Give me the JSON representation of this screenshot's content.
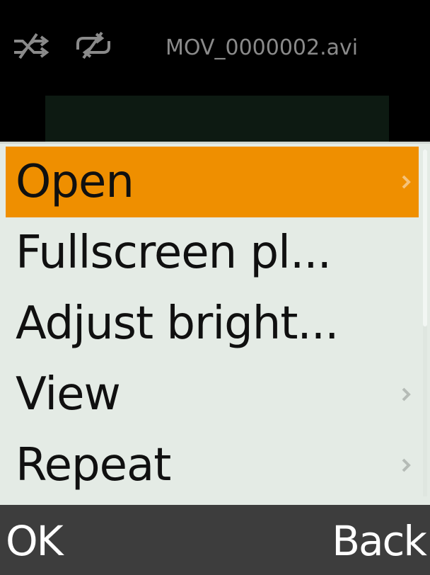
{
  "header": {
    "filename": "MOV_0000002.avi",
    "shuffle_icon": "shuffle-off-icon",
    "repeat_icon": "repeat-off-icon"
  },
  "menu": {
    "items": [
      {
        "label": "Open",
        "has_submenu": true,
        "selected": true
      },
      {
        "label": "Fullscreen pl...",
        "has_submenu": false,
        "selected": false
      },
      {
        "label": "Adjust bright...",
        "has_submenu": false,
        "selected": false
      },
      {
        "label": "View",
        "has_submenu": true,
        "selected": false
      },
      {
        "label": "Repeat",
        "has_submenu": true,
        "selected": false
      }
    ]
  },
  "softkeys": {
    "left": "OK",
    "right": "Back"
  },
  "colors": {
    "selection": "#ef8f00",
    "menu_background": "#e4ebe5",
    "softkey_bar": "#3d3d3d"
  }
}
